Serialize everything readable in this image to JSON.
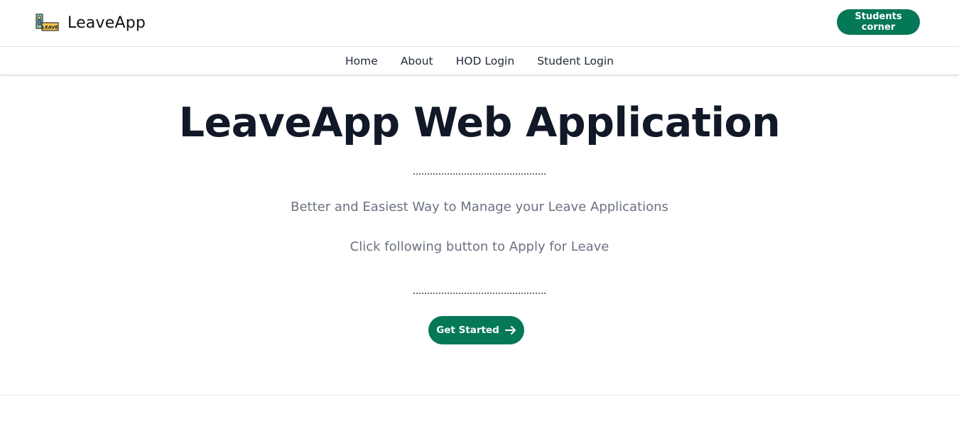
{
  "header": {
    "brand_name": "LeaveApp",
    "logo_icon": "leave-logo-icon",
    "logo_text": "LEAVE",
    "corner_button": "Students corner"
  },
  "nav": {
    "items": [
      "Home",
      "About",
      "HOD Login",
      "Student Login"
    ]
  },
  "hero": {
    "title": "LeaveApp Web Application",
    "subtitle": "Better and Easiest Way to Manage your Leave Applications",
    "instruction": "Click following button to Apply for Leave",
    "cta_label": "Get Started",
    "cta_icon": "arrow-right-icon"
  },
  "colors": {
    "accent": "#047857",
    "title": "#111827",
    "muted": "#6b7280"
  }
}
